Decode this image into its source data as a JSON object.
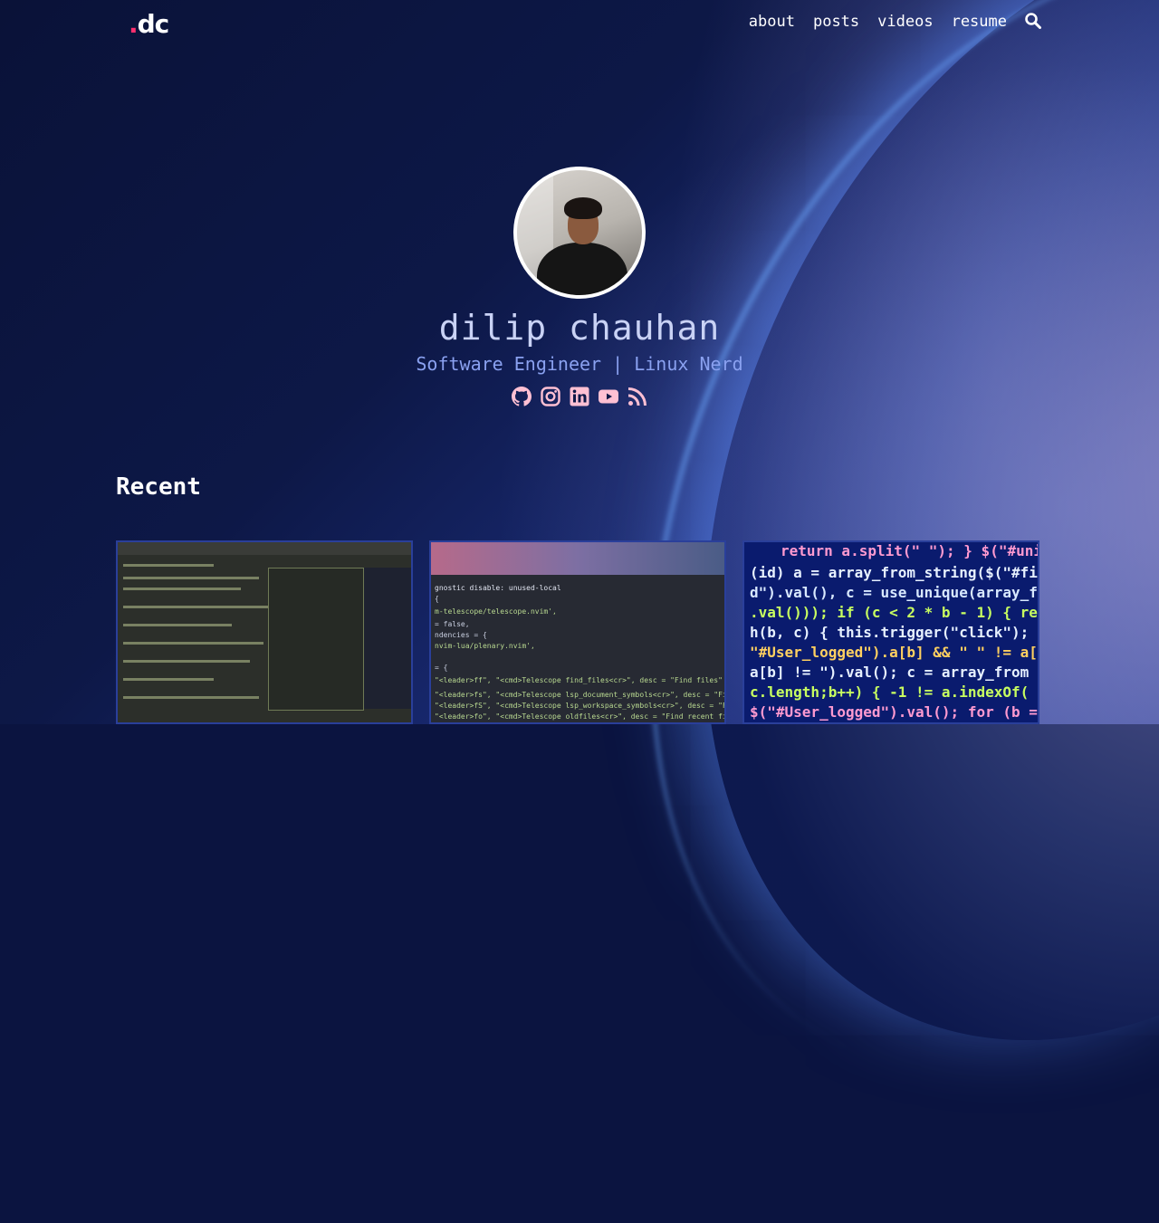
{
  "brand": {
    "dot": ".",
    "name": "dc"
  },
  "nav": {
    "items": [
      "about",
      "posts",
      "videos",
      "resume"
    ],
    "search_icon": "search-icon"
  },
  "profile": {
    "name": "dilip chauhan",
    "tagline": "Software Engineer | Linux Nerd",
    "socials": [
      "github-icon",
      "instagram-icon",
      "linkedin-icon",
      "youtube-icon",
      "rss-icon"
    ]
  },
  "recent": {
    "title": "Recent"
  },
  "colors": {
    "accent": "#ff2f6e",
    "social": "#ffc0d3",
    "name": "#c9d2f5",
    "tagline": "#8aa1f0"
  }
}
